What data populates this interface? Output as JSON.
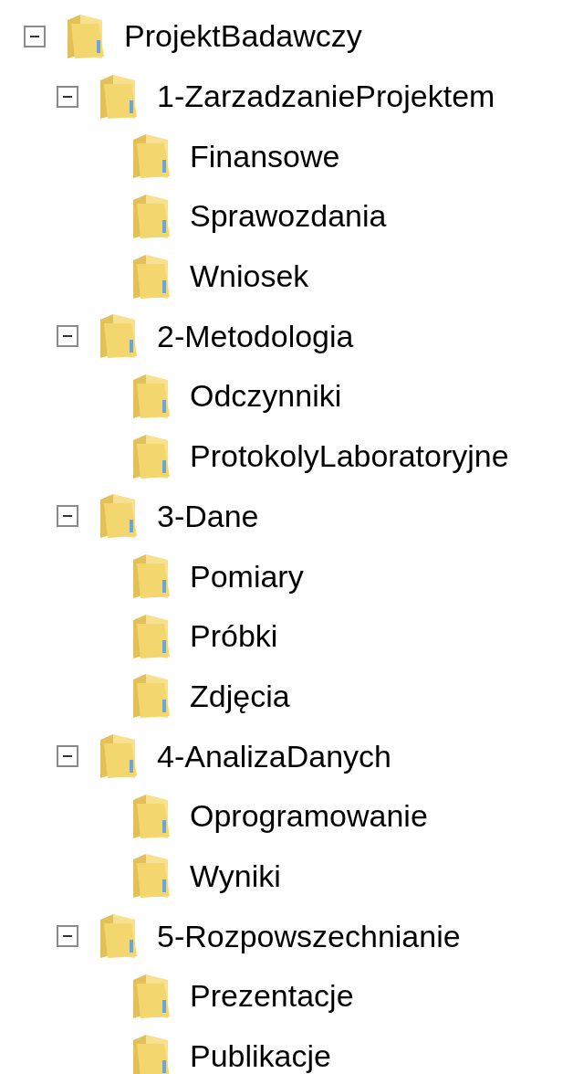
{
  "tree": [
    {
      "label": "ProjektBadawczy",
      "expanded": true,
      "children": [
        {
          "label": "1-ZarzadzanieProjektem",
          "expanded": true,
          "children": [
            {
              "label": "Finansowe"
            },
            {
              "label": "Sprawozdania"
            },
            {
              "label": "Wniosek"
            }
          ]
        },
        {
          "label": "2-Metodologia",
          "expanded": true,
          "children": [
            {
              "label": "Odczynniki"
            },
            {
              "label": "ProtokolyLaboratoryjne"
            }
          ]
        },
        {
          "label": "3-Dane",
          "expanded": true,
          "children": [
            {
              "label": "Pomiary"
            },
            {
              "label": "Próbki"
            },
            {
              "label": "Zdjęcia"
            }
          ]
        },
        {
          "label": "4-AnalizaDanych",
          "expanded": true,
          "children": [
            {
              "label": "Oprogramowanie"
            },
            {
              "label": "Wyniki"
            }
          ]
        },
        {
          "label": "5-Rozpowszechnianie",
          "expanded": true,
          "children": [
            {
              "label": "Prezentacje"
            },
            {
              "label": "Publikacje"
            }
          ]
        }
      ]
    }
  ]
}
